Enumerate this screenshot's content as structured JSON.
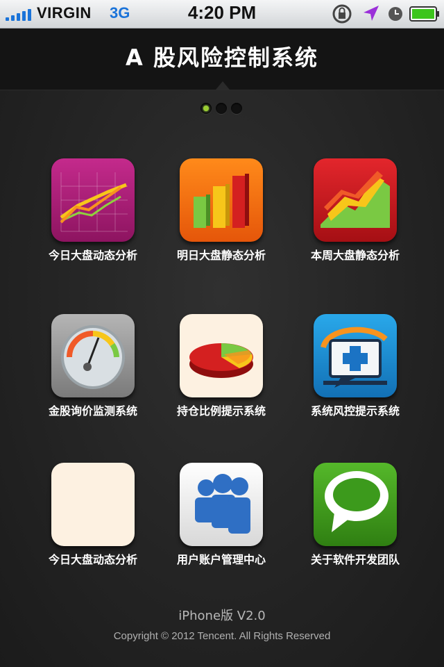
{
  "status_bar": {
    "carrier": "VIRGIN",
    "network": "3G",
    "time": "4:20 PM"
  },
  "header": {
    "title": "A 股风险控制系统"
  },
  "pager": {
    "pages": 3,
    "current": 1
  },
  "tiles": [
    {
      "label": "今日大盘动态分析",
      "icon": "line-chart-icon",
      "color": "#b51f7e"
    },
    {
      "label": "明日大盘静态分析",
      "icon": "bar-chart-icon",
      "color": "#f26b0a"
    },
    {
      "label": "本周大盘静态分析",
      "icon": "area-chart-icon",
      "color": "#c4161c"
    },
    {
      "label": "金股询价监测系统",
      "icon": "gauge-icon",
      "color": "#8f8f8f"
    },
    {
      "label": "持仓比例提示系统",
      "icon": "pie-chart-icon",
      "color": "#fdf1e1"
    },
    {
      "label": "系统风控提示系统",
      "icon": "monitor-medical-icon",
      "color": "#1b8fd6"
    },
    {
      "label": "今日大盘动态分析",
      "icon": "blank-icon",
      "color": "#fdf1e1"
    },
    {
      "label": "用户账户管理中心",
      "icon": "users-icon",
      "color": "#e8e8e8"
    },
    {
      "label": "关于软件开发团队",
      "icon": "chat-bubble-icon",
      "color": "#3c9a1c"
    }
  ],
  "footer": {
    "version": "iPhone版 V2.0",
    "copyright": "Copyright © 2012 Tencent. All Rights Reserved"
  }
}
